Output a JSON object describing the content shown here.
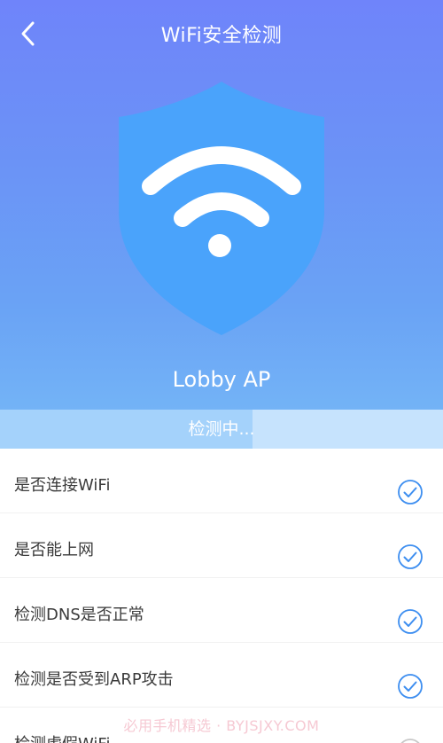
{
  "header": {
    "title": "WiFi安全检测",
    "back_icon": "chevron-left-icon"
  },
  "shield": {
    "icon": "wifi-shield-icon"
  },
  "network": {
    "name": "Lobby AP"
  },
  "scan": {
    "status_text": "检测中...",
    "progress_percent": 57
  },
  "checks": [
    {
      "label": "是否连接WiFi",
      "status": "checked"
    },
    {
      "label": "是否能上网",
      "status": "checked"
    },
    {
      "label": "检测DNS是否正常",
      "status": "checked"
    },
    {
      "label": "检测是否受到ARP攻击",
      "status": "checked"
    },
    {
      "label": "检测虚假WiFi",
      "status": "pending"
    }
  ],
  "watermark": {
    "text": "必用手机精选 · BYJSJXY.COM"
  },
  "colors": {
    "hero_top": "#6f84fa",
    "hero_bottom": "#73b3f6",
    "shield_fill": "#4aa3fb",
    "check_accent": "#3d8ef0",
    "progress_track": "#c6e3fd",
    "progress_fill": "#a4d2fb"
  }
}
